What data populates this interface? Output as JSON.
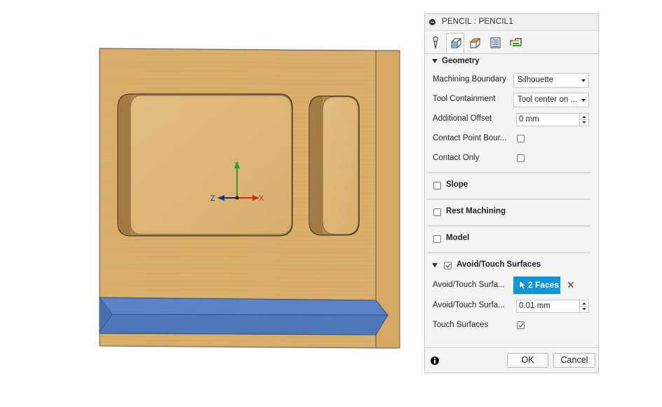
{
  "dialog": {
    "title": "PENCIL : PENCIL1",
    "tabs": [
      {
        "icon": "tool-icon"
      },
      {
        "icon": "geometry-icon"
      },
      {
        "icon": "heights-icon"
      },
      {
        "icon": "passes-icon"
      },
      {
        "icon": "linking-icon"
      }
    ],
    "geometry": {
      "section_label": "Geometry",
      "machining_boundary_label": "Machining Boundary",
      "machining_boundary_value": "Silhouette",
      "tool_containment_label": "Tool Containment",
      "tool_containment_value": "Tool center on ...",
      "additional_offset_label": "Additional Offset",
      "additional_offset_value": "0 mm",
      "contact_point_label": "Contact Point Bour...",
      "contact_point_checked": false,
      "contact_only_label": "Contact Only",
      "contact_only_checked": false
    },
    "slope": {
      "label": "Slope",
      "checked": false
    },
    "rest_machining": {
      "label": "Rest Machining",
      "checked": false
    },
    "model": {
      "label": "Model",
      "checked": false
    },
    "avoid_touch": {
      "label": "Avoid/Touch Surfaces",
      "checked": true,
      "selection_label": "Avoid/Touch Surfa...",
      "selection_value": "2 Faces",
      "clearance_label": "Avoid/Touch Surfa...",
      "clearance_value": "0.01 mm",
      "touch_surfaces_label": "Touch Surfaces",
      "touch_surfaces_checked": true
    },
    "ok_label": "OK",
    "cancel_label": "Cancel"
  },
  "viewport": {
    "triad": {
      "x_label": "X",
      "y_label": "Y",
      "z_label": "Z"
    },
    "colors": {
      "wood": "#d8ad68",
      "selected_faces": "#5b82c4",
      "accent": "#0f96dd"
    }
  }
}
